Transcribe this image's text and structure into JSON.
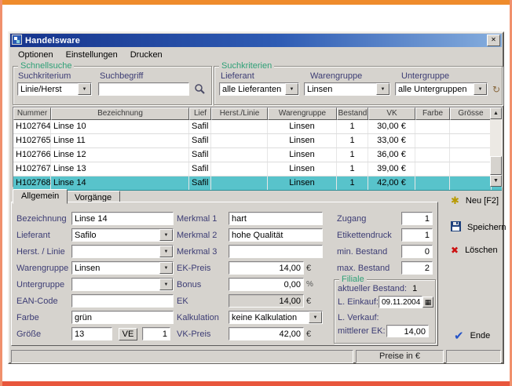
{
  "frame": {
    "top_color": "#ef8b2c",
    "bottom_color": "#e8563c",
    "side_color": "#f0906c"
  },
  "window": {
    "title": "Handelsware",
    "close_glyph": "✕",
    "menu": [
      {
        "label": "Optionen"
      },
      {
        "label": "Einstellungen"
      },
      {
        "label": "Drucken"
      }
    ]
  },
  "search": {
    "title": "Schnellsuche",
    "criterion_label": "Suchkriterium",
    "criterion_value": "Linie/Herst",
    "term_label": "Suchbegriff",
    "term_value": ""
  },
  "filter": {
    "title": "Suchkriterien",
    "supplier_label": "Lieferant",
    "supplier_value": "alle Lieferanten",
    "group_label": "Warengruppe",
    "group_value": "Linsen",
    "subgroup_label": "Untergruppe",
    "subgroup_value": "alle Untergruppen"
  },
  "table": {
    "columns": [
      "Nummer",
      "Bezeichnung",
      "Lief",
      "Herst./Linie",
      "Warengruppe",
      "Bestand",
      "VK",
      "Farbe",
      "Grösse"
    ],
    "rows": [
      {
        "selected": false,
        "cells": [
          "H102764",
          "Linse 10",
          "Safil",
          "",
          "Linsen",
          "1",
          "30,00 €",
          "",
          ""
        ]
      },
      {
        "selected": false,
        "cells": [
          "H102765",
          "Linse 11",
          "Safil",
          "",
          "Linsen",
          "1",
          "33,00 €",
          "",
          ""
        ]
      },
      {
        "selected": false,
        "cells": [
          "H102766",
          "Linse 12",
          "Safil",
          "",
          "Linsen",
          "1",
          "36,00 €",
          "",
          ""
        ]
      },
      {
        "selected": false,
        "cells": [
          "H102767",
          "Linse 13",
          "Safil",
          "",
          "Linsen",
          "1",
          "39,00 €",
          "",
          ""
        ]
      },
      {
        "selected": true,
        "cells": [
          "H102768",
          "Linse 14",
          "Safil",
          "",
          "Linsen",
          "1",
          "42,00 €",
          "",
          ""
        ]
      }
    ]
  },
  "tabs": {
    "general": "Allgemein",
    "transactions": "Vorgänge"
  },
  "form": {
    "left": {
      "bezeichnung_label": "Bezeichnung",
      "bezeichnung_value": "Linse 14",
      "lieferant_label": "Lieferant",
      "lieferant_value": "Safilo",
      "herst_label": "Herst. / Linie",
      "herst_value": "",
      "warengruppe_label": "Warengruppe",
      "warengruppe_value": "Linsen",
      "untergruppe_label": "Untergruppe",
      "untergruppe_value": "",
      "ean_label": "EAN-Code",
      "ean_value": "",
      "farbe_label": "Farbe",
      "farbe_value": "grün",
      "groesse_label": "Größe",
      "groesse_value": "13",
      "ve_label": "VE",
      "ve_value": "1"
    },
    "middle": {
      "merkmal1_label": "Merkmal 1",
      "merkmal1_value": "hart",
      "merkmal2_label": "Merkmal 2",
      "merkmal2_value": "hohe Qualität",
      "merkmal3_label": "Merkmal 3",
      "merkmal3_value": "",
      "ek_preis_label": "EK-Preis",
      "ek_preis_value": "14,00",
      "bonus_label": "Bonus",
      "bonus_value": "0,00",
      "ek_label": "EK",
      "ek_value": "14,00",
      "kalkulation_label": "Kalkulation",
      "kalkulation_value": "keine Kalkulation",
      "vk_preis_label": "VK-Preis",
      "vk_preis_value": "42,00",
      "currency": "€",
      "percent": "%"
    },
    "right": {
      "zugang_label": "Zugang",
      "zugang_value": "1",
      "etiketten_label": "Etikettendruck",
      "etiketten_value": "1",
      "min_label": "min. Bestand",
      "min_value": "0",
      "max_label": "max. Bestand",
      "max_value": "2"
    },
    "filiale": {
      "title": "Filiale",
      "bestand_label": "aktueller Bestand:",
      "bestand_value": "1",
      "einkauf_label": "L. Einkauf:",
      "einkauf_value": "09.11.2004",
      "verkauf_label": "L. Verkauf:",
      "verkauf_value": "",
      "ek_label": "mittlerer EK:",
      "ek_value": "14,00"
    }
  },
  "actions": {
    "neu": "Neu [F2]",
    "speichern": "Speichern",
    "loeschen": "Löschen",
    "ende": "Ende"
  },
  "statusbar": {
    "preise": "Preise in €"
  }
}
